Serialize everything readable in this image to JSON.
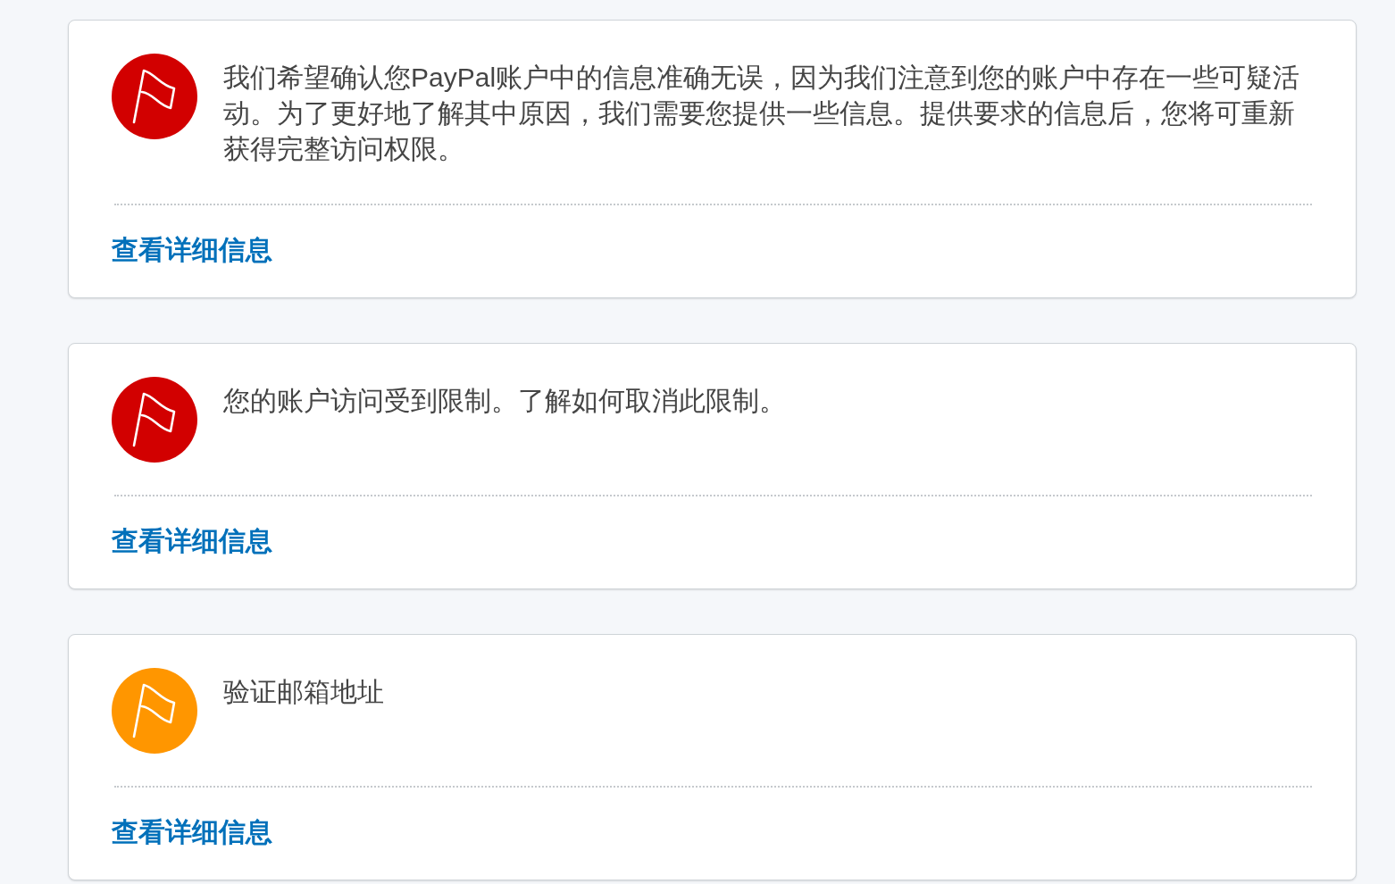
{
  "alerts": [
    {
      "color": "#d20000",
      "message": "我们希望确认您PayPal账户中的信息准确无误，因为我们注意到您的账户中存在一些可疑活动。为了更好地了解其中原因，我们需要您提供一些信息。提供要求的信息后，您将可重新获得完整访问权限。",
      "link": "查看详细信息"
    },
    {
      "color": "#d20000",
      "message": "您的账户访问受到限制。了解如何取消此限制。",
      "link": "查看详细信息"
    },
    {
      "color": "#ff9600",
      "message": "验证邮箱地址",
      "link": "查看详细信息"
    }
  ]
}
